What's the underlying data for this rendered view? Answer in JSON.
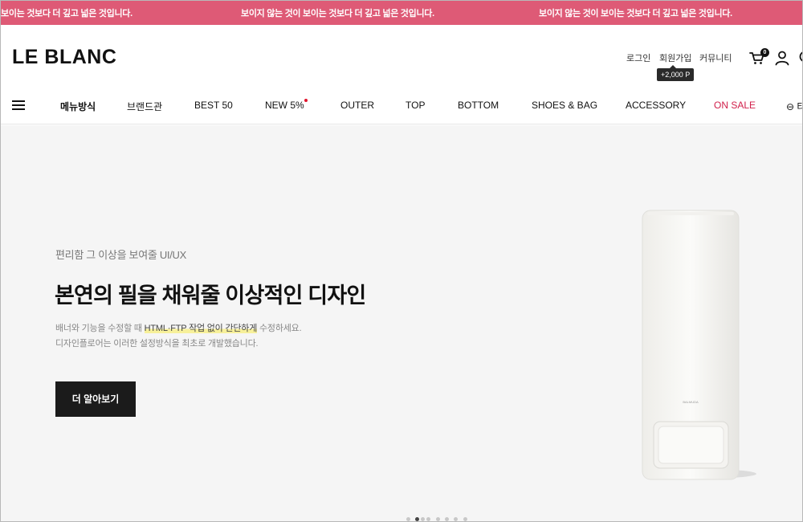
{
  "announcement": {
    "messages": [
      "보이는 것보다 더 깊고 넓은 것입니다.",
      "보이지 않는 것이 보이는 것보다 더 깊고 넓은 것입니다.",
      "보이지 않는 것이 보이는 것보다 더 깊고 넓은 것입니다."
    ]
  },
  "header": {
    "logo": "LE BLANC",
    "util_links": {
      "login": "로그인",
      "join": "회원가입",
      "community": "커뮤니티"
    },
    "join_tooltip": "+2,000 P",
    "cart_count": "0"
  },
  "nav": {
    "items": [
      "메뉴방식",
      "브랜드관",
      "BEST 50",
      "NEW 5%",
      "OUTER",
      "TOP",
      "BOTTOM",
      "SHOES & BAG",
      "ACCESSORY",
      "ON SALE"
    ],
    "more_label": "⊖ 타"
  },
  "hero": {
    "subtitle": "편리함 그 이상을 보여줄 UI/UX",
    "title": "본연의 필을 채워줄 이상적인 디자인",
    "desc_line1_pre": "배너와 기능을 수정할 때 ",
    "desc_line1_hl": "HTML·FTP 작업 없이 간단하게",
    "desc_line1_post": " 수정하세요.",
    "desc_line2": "디자인플로어는 이러한 설정방식을 최초로 개발했습니다.",
    "cta_label": "더 알아보기",
    "product_brand": "BALMUDA",
    "slide_count": 7,
    "active_slide": 2
  },
  "colors": {
    "announcement_bg": "#de5a76",
    "sale_text": "#d1204b",
    "cta_bg": "#1b1b1b",
    "highlight": "#f7f09a"
  }
}
